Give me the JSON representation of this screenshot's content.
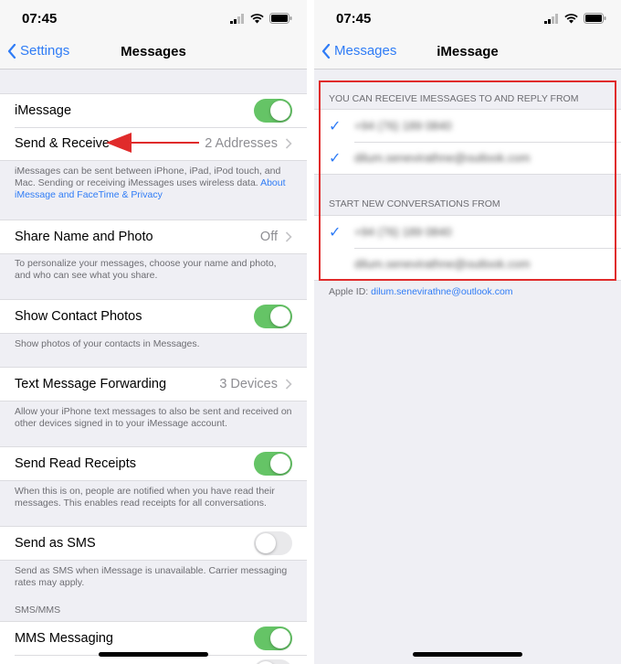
{
  "colors": {
    "accent": "#2f7cf6",
    "toggle_on": "#65c466",
    "toggle_off": "#e9e9eb",
    "annotation": "#e02b2b"
  },
  "left": {
    "status_time": "07:45",
    "back_label": "Settings",
    "title": "Messages",
    "imessage": {
      "label": "iMessage",
      "on": true
    },
    "send_receive": {
      "label": "Send & Receive",
      "detail": "2 Addresses"
    },
    "imessage_footer": "iMessages can be sent between iPhone, iPad, iPod touch, and Mac. Sending or receiving iMessages uses wireless data.",
    "imessage_footer_link": "About iMessage and FaceTime & Privacy",
    "share_name": {
      "label": "Share Name and Photo",
      "detail": "Off"
    },
    "share_footer": "To personalize your messages, choose your name and photo, and who can see what you share.",
    "contact_photos": {
      "label": "Show Contact Photos",
      "on": true
    },
    "contact_footer": "Show photos of your contacts in Messages.",
    "forwarding": {
      "label": "Text Message Forwarding",
      "detail": "3 Devices"
    },
    "forwarding_footer": "Allow your iPhone text messages to also be sent and received on other devices signed in to your iMessage account.",
    "read_receipts": {
      "label": "Send Read Receipts",
      "on": true
    },
    "read_footer": "When this is on, people are notified when you have read their messages. This enables read receipts for all conversations.",
    "send_sms": {
      "label": "Send as SMS",
      "on": false
    },
    "sms_footer": "Send as SMS when iMessage is unavailable. Carrier messaging rates may apply.",
    "sms_mms_header": "SMS/MMS",
    "mms": {
      "label": "MMS Messaging",
      "on": true
    }
  },
  "right": {
    "status_time": "07:45",
    "back_label": "Messages",
    "title": "iMessage",
    "receive_header": "YOU CAN RECEIVE IMESSAGES TO AND REPLY FROM",
    "receive_items": [
      {
        "value": "+94 (76) 189 0840",
        "checked": true
      },
      {
        "value": "dilum.senevirathne@outlook.com",
        "checked": true
      }
    ],
    "start_header": "START NEW CONVERSATIONS FROM",
    "start_items": [
      {
        "value": "+94 (76) 189 0840",
        "checked": true
      },
      {
        "value": "dilum.senevirathne@outlook.com",
        "checked": false
      }
    ],
    "apple_id_label": "Apple ID:",
    "apple_id_value": "dilum.senevirathne@outlook.com"
  }
}
